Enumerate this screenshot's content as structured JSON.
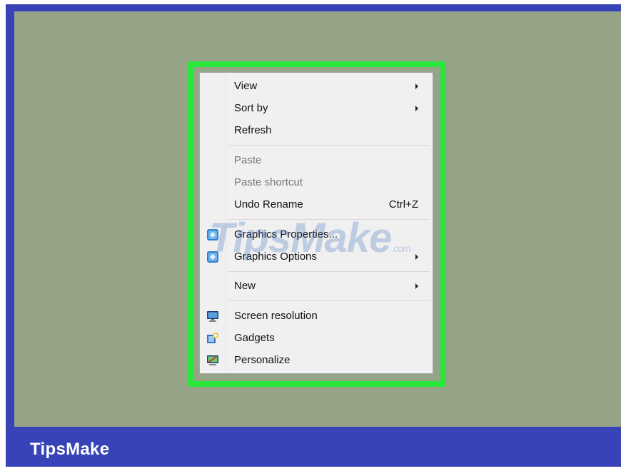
{
  "brand": "TipsMake",
  "watermark": {
    "main": "TipsMake",
    "suffix": ".com"
  },
  "menu": {
    "items": [
      {
        "label": "View",
        "submenu": true
      },
      {
        "label": "Sort by",
        "submenu": true
      },
      {
        "label": "Refresh"
      },
      {
        "label": "Paste",
        "disabled": true
      },
      {
        "label": "Paste shortcut",
        "disabled": true
      },
      {
        "label": "Undo Rename",
        "shortcut": "Ctrl+Z"
      },
      {
        "label": "Graphics Properties...",
        "icon": "intel-graphics-icon"
      },
      {
        "label": "Graphics Options",
        "icon": "intel-graphics-icon",
        "submenu": true
      },
      {
        "label": "New",
        "submenu": true
      },
      {
        "label": "Screen resolution",
        "icon": "monitor-icon"
      },
      {
        "label": "Gadgets",
        "icon": "gadgets-icon"
      },
      {
        "label": "Personalize",
        "icon": "personalize-icon"
      }
    ]
  },
  "colors": {
    "frame": "#3843b8",
    "desktop": "#95a487",
    "highlight": "#29e63a",
    "menu_bg": "#f0f0f0"
  }
}
